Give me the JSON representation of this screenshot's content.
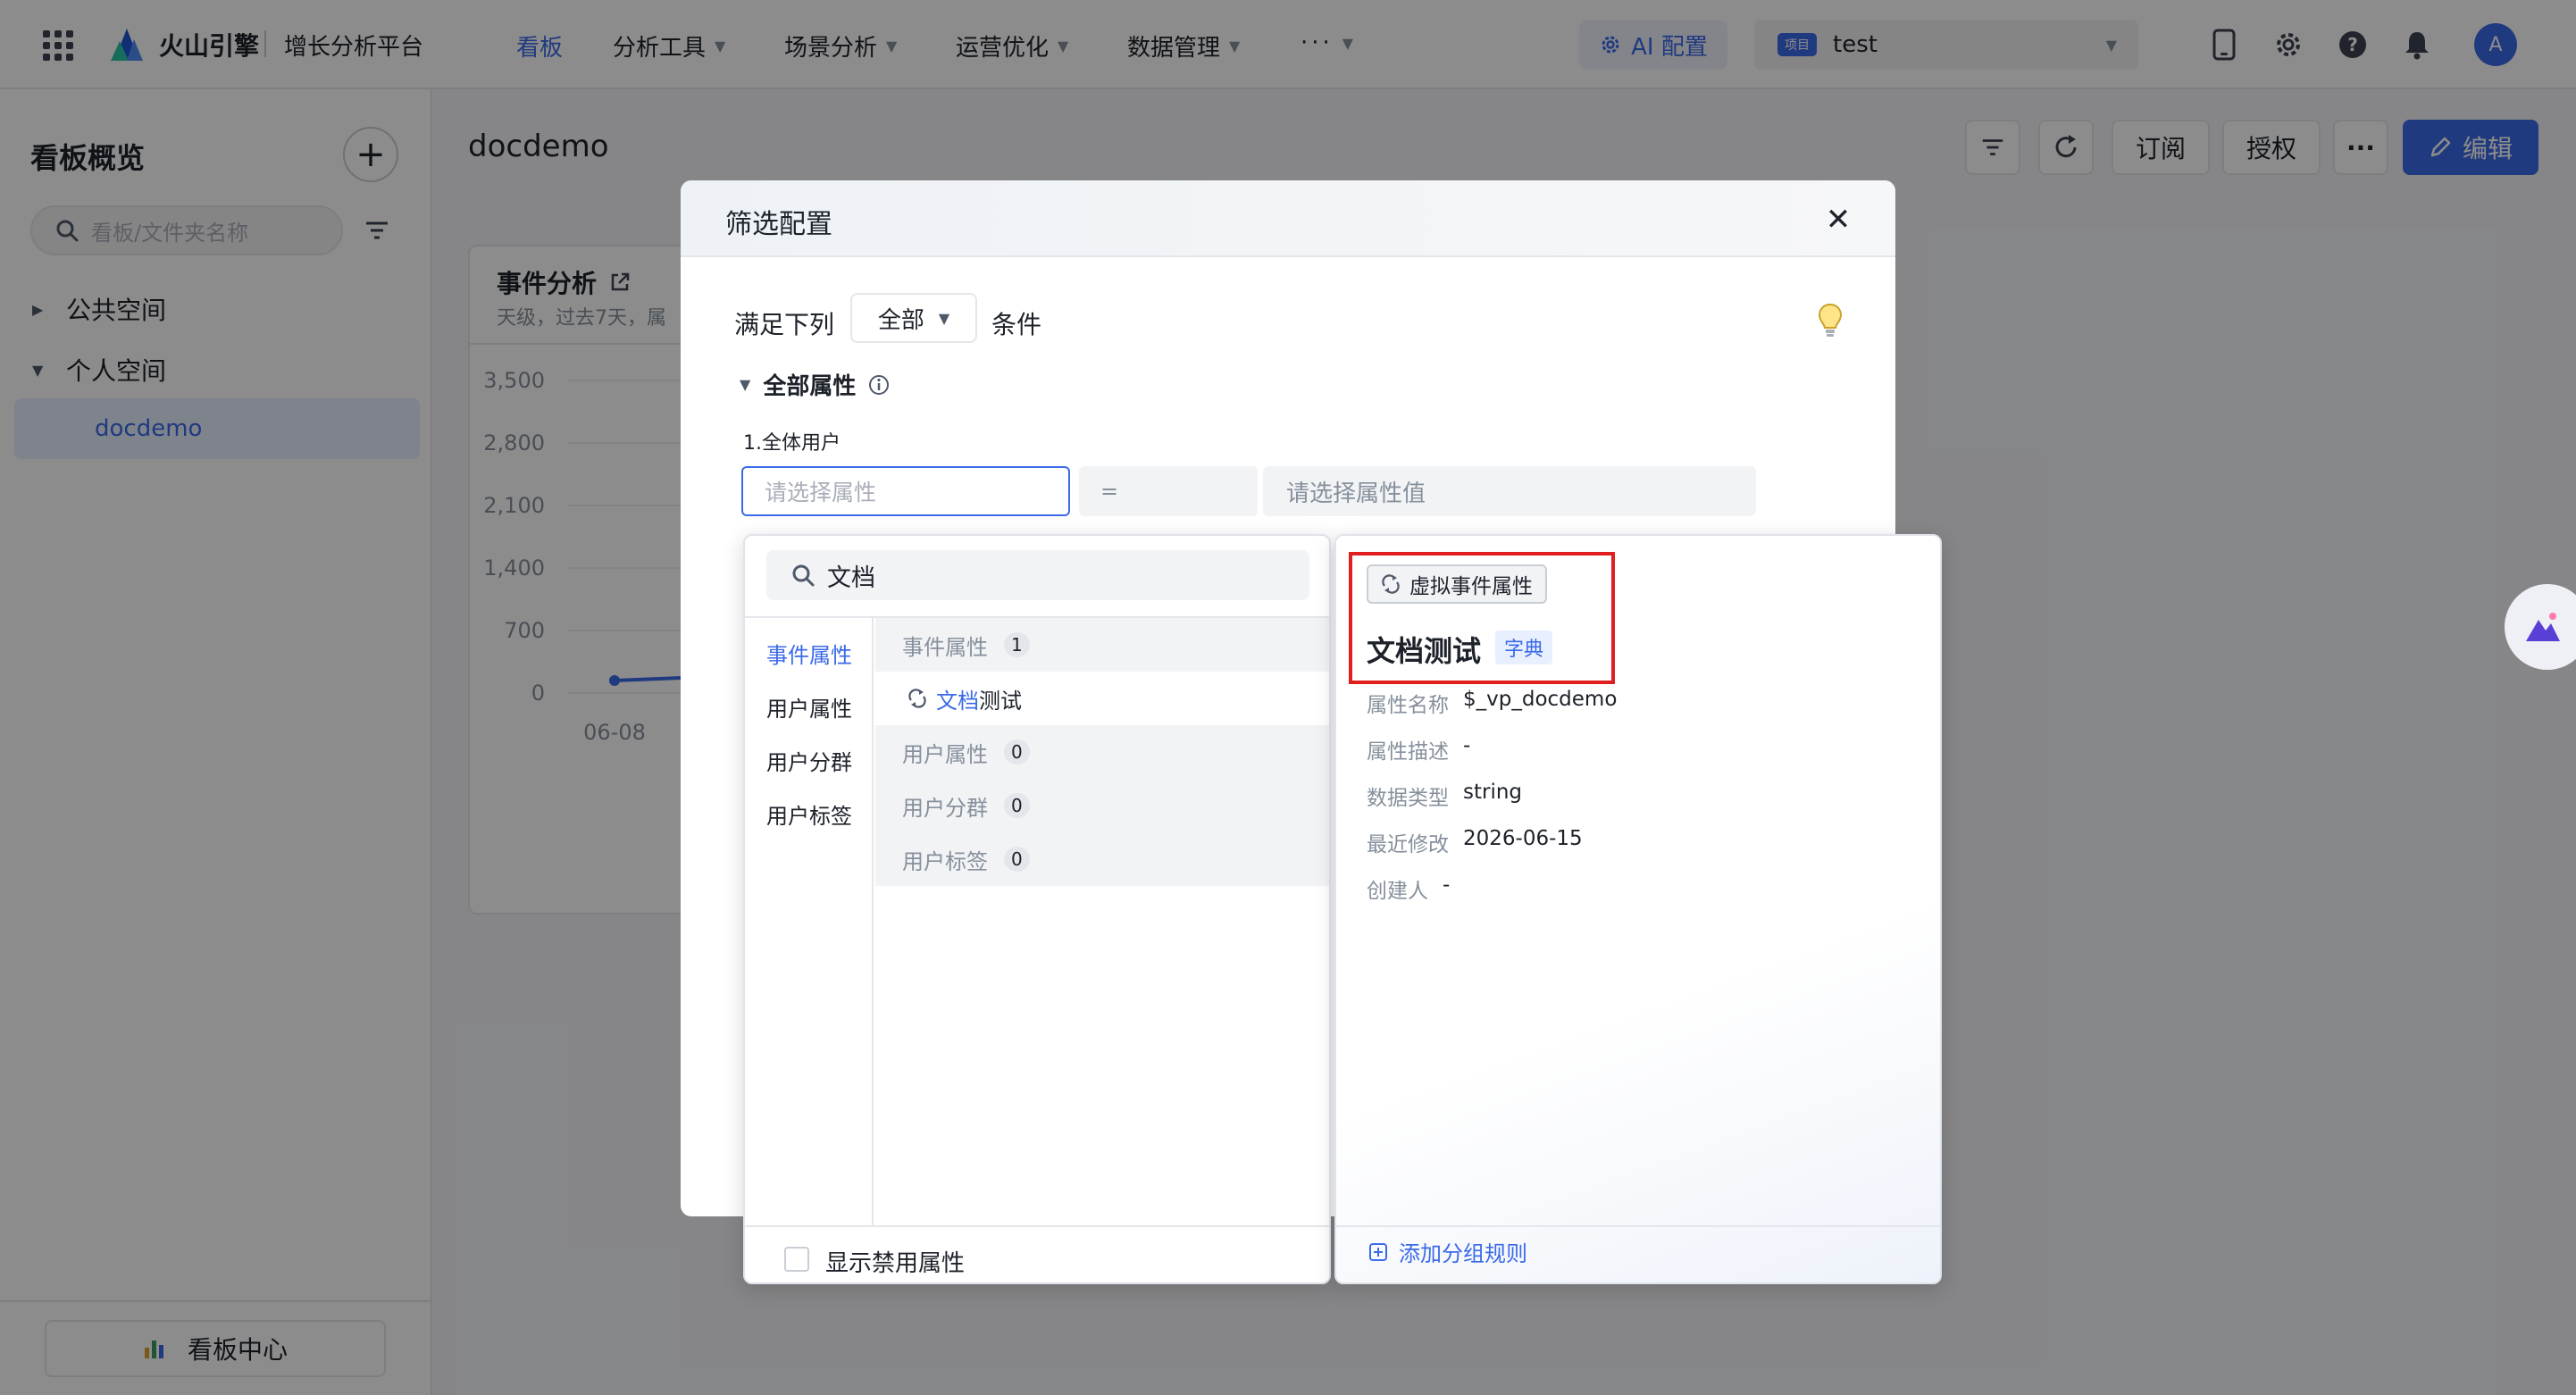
{
  "topbar": {
    "brand": "火山引擎",
    "product": "增长分析平台",
    "nav": [
      {
        "label": "看板",
        "active": true
      },
      {
        "label": "分析工具"
      },
      {
        "label": "场景分析"
      },
      {
        "label": "运营优化"
      },
      {
        "label": "数据管理"
      },
      {
        "label": "···"
      }
    ],
    "ai_config": "AI 配置",
    "project_badge": "项目",
    "project_name": "test",
    "avatar": "A",
    "icons": [
      "apps-grid-icon",
      "mobile-icon",
      "settings-icon",
      "help-icon",
      "bell-icon"
    ]
  },
  "sidebar": {
    "title": "看板概览",
    "search_placeholder": "看板/文件夹名称",
    "tree": [
      {
        "label": "公共空间",
        "expanded": false
      },
      {
        "label": "个人空间",
        "expanded": true,
        "children": [
          {
            "label": "docdemo",
            "selected": true
          }
        ]
      }
    ],
    "footer_button": "看板中心"
  },
  "main": {
    "page_title": "docdemo",
    "toolbar": {
      "subscribe": "订阅",
      "authorize": "授权",
      "more": "···",
      "edit": "编辑"
    },
    "card": {
      "title": "事件分析",
      "subtitle": "天级，过去7天，属"
    }
  },
  "chart_data": {
    "type": "line",
    "y_ticks": [
      "3,500",
      "2,800",
      "2,100",
      "1,400",
      "700",
      "0"
    ],
    "x_ticks": [
      "06-08"
    ],
    "ylim": [
      0,
      3500
    ],
    "series": [
      {
        "x": [
          "06-08"
        ],
        "values": [
          0
        ]
      }
    ]
  },
  "modal": {
    "title": "筛选配置",
    "satisfy_prefix": "满足下列",
    "match_value": "全部",
    "satisfy_suffix": "条件",
    "group_title": "全部属性",
    "condition_label": "1.全体用户",
    "property_placeholder": "请选择属性",
    "operator": "=",
    "value_placeholder": "请选择属性值"
  },
  "dropdown": {
    "search_value": "文档",
    "categories": [
      "事件属性",
      "用户属性",
      "用户分群",
      "用户标签"
    ],
    "groups": [
      {
        "label": "事件属性",
        "count": "1"
      },
      {
        "label": "用户属性",
        "count": "0"
      },
      {
        "label": "用户分群",
        "count": "0"
      },
      {
        "label": "用户标签",
        "count": "0"
      }
    ],
    "result_item": {
      "highlight": "文档",
      "rest": "测试"
    },
    "show_disabled": "显示禁用属性"
  },
  "detail": {
    "tag": "虚拟事件属性",
    "title": "文档测试",
    "dictionary_tag": "字典",
    "rows": [
      {
        "key": "属性名称",
        "value": "$_vp_docdemo"
      },
      {
        "key": "属性描述",
        "value": "-"
      },
      {
        "key": "数据类型",
        "value": "string"
      },
      {
        "key": "最近修改",
        "value": "2026-06-15"
      },
      {
        "key": "创建人",
        "value": "-"
      }
    ],
    "add_rule": "添加分组规则"
  },
  "colors": {
    "primary": "#3b6ae8",
    "highlight_box": "#e01e1e"
  }
}
